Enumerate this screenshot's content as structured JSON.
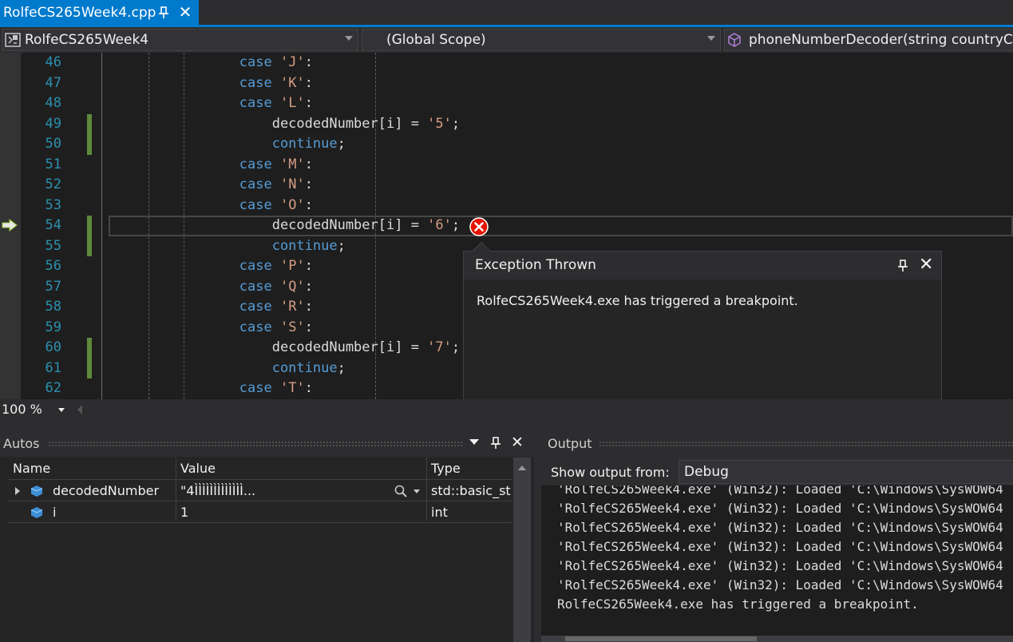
{
  "tab": {
    "file_name": "RolfeCS265Week4.cpp",
    "close_glyph": "✕"
  },
  "nav": {
    "project": "RolfeCS265Week4",
    "scope": "(Global Scope)",
    "member": "phoneNumberDecoder(string countryCode"
  },
  "editor": {
    "lines": [
      {
        "n": "46",
        "changed": false
      },
      {
        "n": "47",
        "changed": false
      },
      {
        "n": "48",
        "changed": false
      },
      {
        "n": "49",
        "changed": true
      },
      {
        "n": "50",
        "changed": true
      },
      {
        "n": "51",
        "changed": false
      },
      {
        "n": "52",
        "changed": false
      },
      {
        "n": "53",
        "changed": false
      },
      {
        "n": "54",
        "changed": true
      },
      {
        "n": "55",
        "changed": true
      },
      {
        "n": "56",
        "changed": false
      },
      {
        "n": "57",
        "changed": false
      },
      {
        "n": "58",
        "changed": false
      },
      {
        "n": "59",
        "changed": false
      },
      {
        "n": "60",
        "changed": true
      },
      {
        "n": "61",
        "changed": true
      },
      {
        "n": "62",
        "changed": false
      }
    ],
    "tokens": {
      "case": "case",
      "continue": "continue",
      "assign_prefix": "decodedNumber[i] = ",
      "semicolon": ";",
      "colon": ":",
      "chars": {
        "J": "'J'",
        "K": "'K'",
        "L": "'L'",
        "five": "'5'",
        "M": "'M'",
        "N": "'N'",
        "O": "'O'",
        "six": "'6'",
        "P": "'P'",
        "Q": "'Q'",
        "R": "'R'",
        "S": "'S'",
        "seven": "'7'",
        "T": "'T'"
      }
    }
  },
  "exception": {
    "title": "Exception Thrown",
    "message": "RolfeCS265Week4.exe has triggered a breakpoint."
  },
  "zoom": {
    "level": "100 %"
  },
  "autos": {
    "title": "Autos",
    "columns": {
      "name": "Name",
      "value": "Value",
      "type": "Type"
    },
    "rows": [
      {
        "name": "decodedNumber",
        "value": "\"4ÌÌÌÌÌÌÌÌÌÌÌÌÌ...",
        "type": "std::basic_string"
      },
      {
        "name": "i",
        "value": "1",
        "type": "int"
      }
    ]
  },
  "output": {
    "title": "Output",
    "show_label": "Show output from:",
    "source": "Debug",
    "lines": [
      "'RolfeCS265Week4.exe' (Win32): Loaded 'C:\\Windows\\SysWOW64",
      "'RolfeCS265Week4.exe' (Win32): Loaded 'C:\\Windows\\SysWOW64",
      "'RolfeCS265Week4.exe' (Win32): Loaded 'C:\\Windows\\SysWOW64",
      "'RolfeCS265Week4.exe' (Win32): Loaded 'C:\\Windows\\SysWOW64",
      "'RolfeCS265Week4.exe' (Win32): Loaded 'C:\\Windows\\SysWOW64",
      "'RolfeCS265Week4.exe' (Win32): Loaded 'C:\\Windows\\SysWOW64",
      "RolfeCS265Week4.exe has triggered a breakpoint."
    ]
  }
}
